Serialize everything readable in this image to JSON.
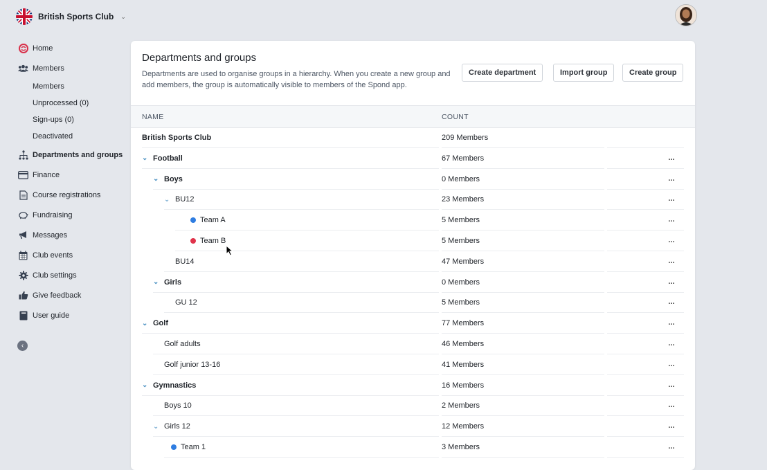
{
  "header": {
    "club_name": "British Sports Club"
  },
  "sidebar": {
    "items": [
      {
        "label": "Home",
        "icon": "spond-logo-icon"
      },
      {
        "label": "Members",
        "icon": "people-icon"
      },
      {
        "label": "Members",
        "sub": true
      },
      {
        "label": "Unprocessed (0)",
        "sub": true
      },
      {
        "label": "Sign-ups (0)",
        "sub": true
      },
      {
        "label": "Deactivated",
        "sub": true
      },
      {
        "label": "Departments and groups",
        "icon": "hierarchy-icon",
        "active": true
      },
      {
        "label": "Finance",
        "icon": "card-icon"
      },
      {
        "label": "Course registrations",
        "icon": "document-icon"
      },
      {
        "label": "Fundraising",
        "icon": "piggy-bank-icon"
      },
      {
        "label": "Messages",
        "icon": "megaphone-icon"
      },
      {
        "label": "Club events",
        "icon": "calendar-icon"
      },
      {
        "label": "Club settings",
        "icon": "gear-icon"
      },
      {
        "label": "Give feedback",
        "icon": "thumbs-up-icon"
      },
      {
        "label": "User guide",
        "icon": "book-icon"
      }
    ]
  },
  "main": {
    "title": "Departments and groups",
    "description": "Departments are used to organise groups in a hierarchy. When you create a new group and add members, the group is automatically visible to members of the Spond app.",
    "buttons": {
      "create_department": "Create department",
      "import_group": "Import group",
      "create_group": "Create group"
    },
    "columns": {
      "name": "NAME",
      "count": "COUNT"
    },
    "more_label": "...",
    "rows": [
      {
        "name": "British Sports Club",
        "count": "209 Members",
        "level": 0,
        "bold": true,
        "caret": false
      },
      {
        "name": "Football",
        "count": "67 Members",
        "level": 0,
        "bold": true,
        "caret": true
      },
      {
        "name": "Boys",
        "count": "0 Members",
        "level": 1,
        "bold": true,
        "caret": true
      },
      {
        "name": "BU12",
        "count": "23 Members",
        "level": 2,
        "bold": false,
        "caret": true
      },
      {
        "name": "Team A",
        "count": "5 Members",
        "level": 3,
        "dot": "#2f7de1"
      },
      {
        "name": "Team B",
        "count": "5 Members",
        "level": 3,
        "dot": "#e0334b"
      },
      {
        "name": "BU14",
        "count": "47 Members",
        "level": 2,
        "bold": false,
        "caret": false
      },
      {
        "name": "Girls",
        "count": "0 Members",
        "level": 1,
        "bold": true,
        "caret": true
      },
      {
        "name": "GU 12",
        "count": "5 Members",
        "level": 2,
        "bold": false,
        "caret": false
      },
      {
        "name": "Golf",
        "count": "77 Members",
        "level": 0,
        "bold": true,
        "caret": true
      },
      {
        "name": "Golf adults",
        "count": "46 Members",
        "level": 1,
        "bold": false,
        "caret": false
      },
      {
        "name": "Golf junior 13-16",
        "count": "41 Members",
        "level": 1,
        "bold": false,
        "caret": false
      },
      {
        "name": "Gymnastics",
        "count": "16 Members",
        "level": 0,
        "bold": true,
        "caret": true
      },
      {
        "name": "Boys 10",
        "count": "2 Members",
        "level": 1,
        "bold": false,
        "caret": false
      },
      {
        "name": "Girls 12",
        "count": "12 Members",
        "level": 1,
        "bold": false,
        "caret": true
      },
      {
        "name": "Team 1",
        "count": "3 Members",
        "level": 2,
        "dot": "#2f7de1"
      }
    ]
  }
}
